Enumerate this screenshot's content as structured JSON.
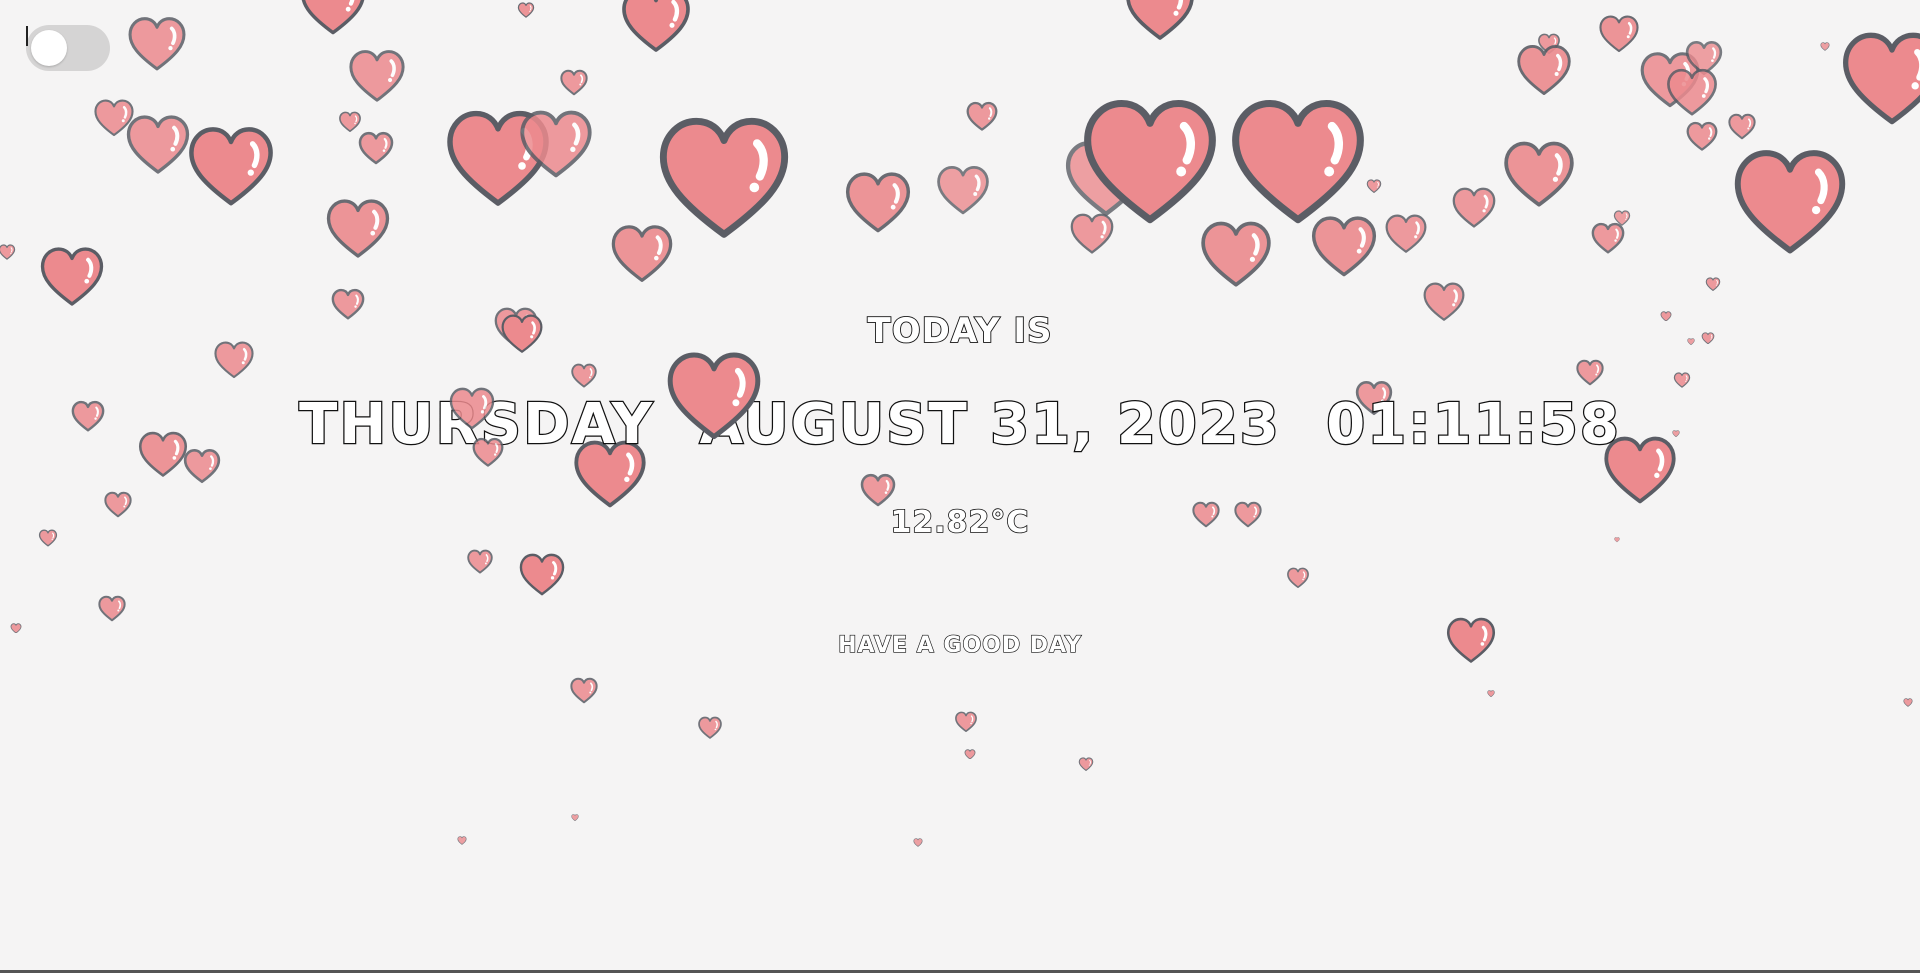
{
  "toggle": {
    "label": "theme-toggle",
    "state": "off"
  },
  "display": {
    "today_label": "TODAY IS",
    "weekday": "THURSDAY",
    "date": "AUGUST 31, 2023",
    "time": "01:11:58",
    "temperature": "12.82°C",
    "greeting": "HAVE A GOOD DAY"
  },
  "colors": {
    "background": "#f5f4f4",
    "heart_fill": "#ec8a8e",
    "heart_outline": "#5b5d65",
    "heart_highlight": "#ffffff"
  },
  "decoration": {
    "icon": "heart-icon",
    "animation": "falling-hearts"
  }
}
